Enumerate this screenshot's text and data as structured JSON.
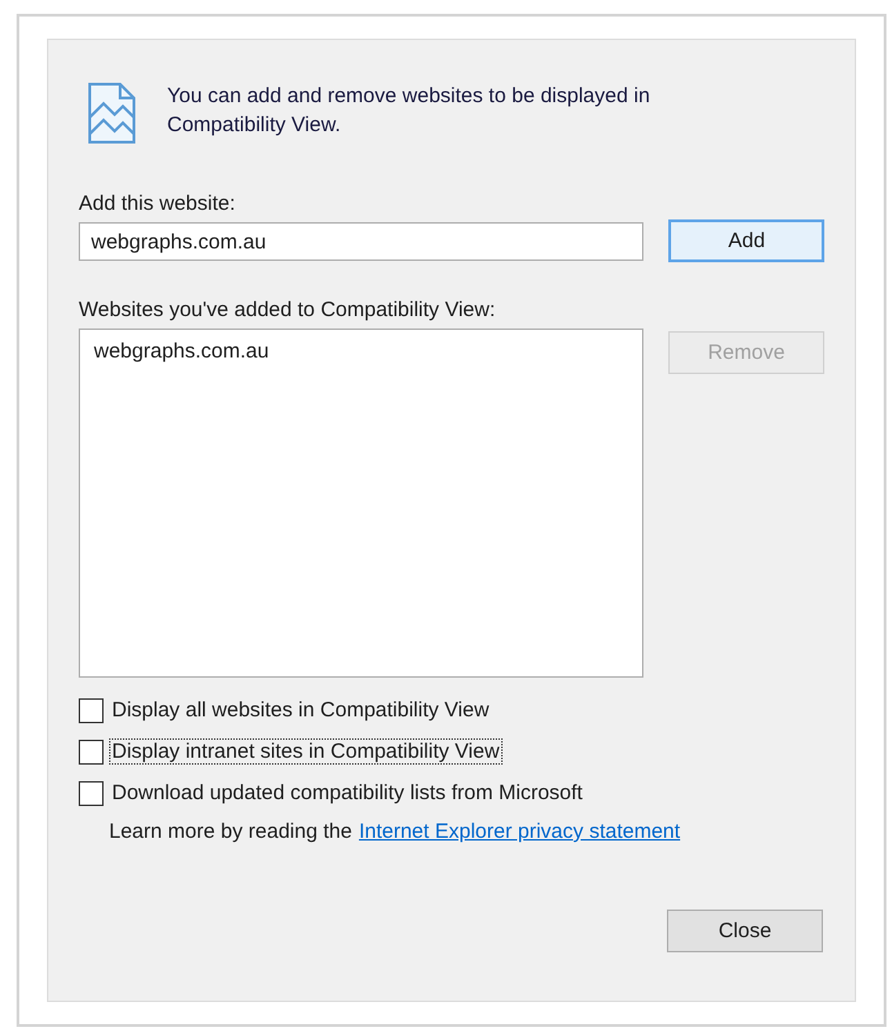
{
  "intro": "You can add and remove websites to be displayed in Compatibility View.",
  "add_field": {
    "label": "Add this website:",
    "value": "webgraphs.com.au"
  },
  "add_button": {
    "label": "Add",
    "disabled": false,
    "default": true
  },
  "list": {
    "label": "Websites you've added to Compatibility View:",
    "items": [
      {
        "text": "webgraphs.com.au",
        "selected": false
      }
    ]
  },
  "remove_button": {
    "label": "Remove",
    "disabled": true,
    "default": false
  },
  "options": [
    {
      "label": "Display all websites in Compatibility View",
      "checked": false,
      "focused": false
    },
    {
      "label": "Display intranet sites in Compatibility View",
      "checked": false,
      "focused": true
    },
    {
      "label": "Download updated compatibility lists from Microsoft",
      "checked": false,
      "focused": false
    }
  ],
  "learn_more": {
    "text": "Learn more by reading the",
    "link": "Internet Explorer privacy statement"
  },
  "close_button": {
    "label": "Close",
    "disabled": false,
    "default": false
  }
}
